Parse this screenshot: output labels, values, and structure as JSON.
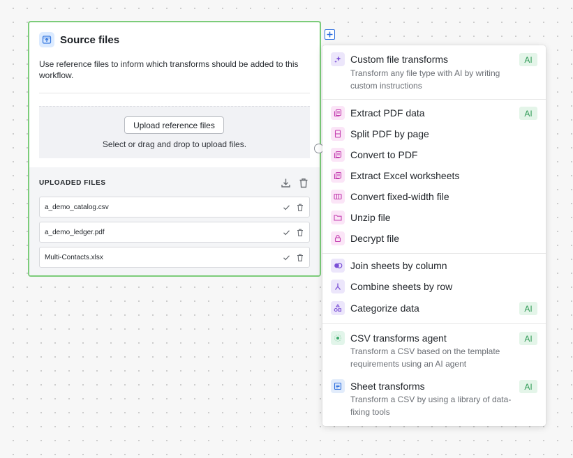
{
  "source_card": {
    "title": "Source files",
    "description": "Use reference files to inform which transforms should be added to this workflow.",
    "upload_button": "Upload reference files",
    "upload_hint": "Select or drag and drop to upload files.",
    "uploaded_title": "UPLOADED FILES",
    "files": [
      {
        "name": "a_demo_catalog.csv"
      },
      {
        "name": "a_demo_ledger.pdf"
      },
      {
        "name": "Multi-Contacts.xlsx"
      }
    ]
  },
  "menu": {
    "ai_label": "AI",
    "items": [
      {
        "label": "Custom file transforms",
        "description": "Transform any file type with AI by writing custom instructions",
        "icon": "sparkles-icon"
      },
      {
        "label": "Extract PDF data",
        "icon": "document-stack-icon"
      },
      {
        "label": "Split PDF by page",
        "icon": "split-document-icon"
      },
      {
        "label": "Convert to PDF",
        "icon": "document-stack-icon"
      },
      {
        "label": "Extract Excel worksheets",
        "icon": "document-stack-icon"
      },
      {
        "label": "Convert fixed-width file",
        "icon": "columns-icon"
      },
      {
        "label": "Unzip file",
        "icon": "folder-icon"
      },
      {
        "label": "Decrypt file",
        "icon": "lock-icon"
      },
      {
        "label": "Join sheets by column",
        "icon": "join-icon"
      },
      {
        "label": "Combine sheets by row",
        "icon": "merge-icon"
      },
      {
        "label": "Categorize data",
        "icon": "shapes-icon"
      },
      {
        "label": "CSV transforms agent",
        "description": "Transform a CSV based on the template requirements using an AI agent",
        "icon": "agent-icon"
      },
      {
        "label": "Sheet transforms",
        "description": "Transform a CSV by using a library of data-fixing tools",
        "icon": "sheet-icon"
      }
    ]
  },
  "colors": {
    "card_border": "#7ccc7a",
    "accent_blue": "#2f6fde",
    "ai_badge_bg": "#e4f5e9",
    "ai_badge_text": "#2e9a55",
    "icon_pink": "#c43fb0",
    "icon_purple": "#7a4fd6"
  }
}
